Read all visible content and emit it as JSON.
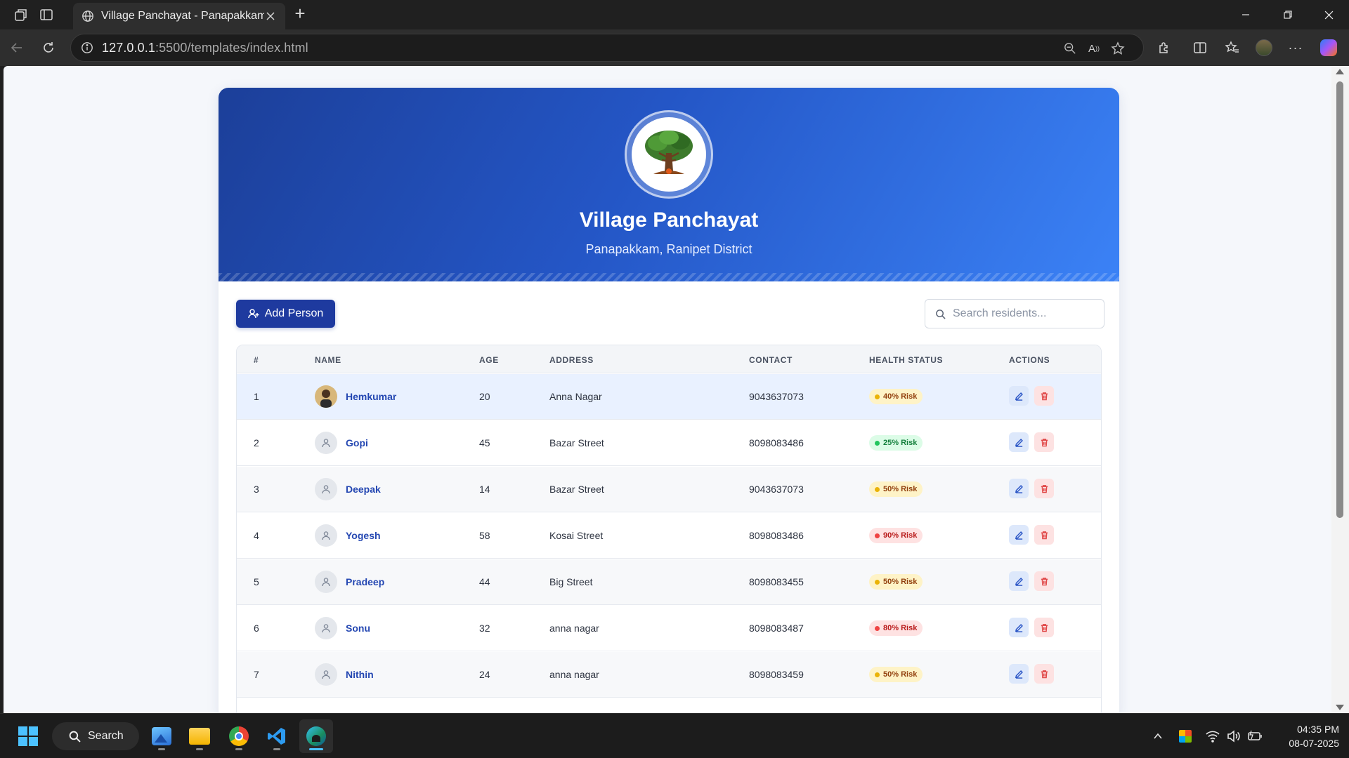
{
  "browser": {
    "tab_title": "Village Panchayat - Panapakkam",
    "url_host": "127.0.0.1",
    "url_path": ":5500/templates/index.html",
    "zoom_label": "A↑"
  },
  "header": {
    "title": "Village Panchayat",
    "subtitle": "Panapakkam, Ranipet District",
    "gradient_start": "#1c3f99",
    "gradient_end": "#3b82f6"
  },
  "toolbar": {
    "add_label": "Add Person",
    "search_placeholder": "Search residents..."
  },
  "table": {
    "columns": [
      "#",
      "NAME",
      "AGE",
      "ADDRESS",
      "CONTACT",
      "HEALTH STATUS",
      "ACTIONS"
    ],
    "rows": [
      {
        "num": "1",
        "name": "Hemkumar",
        "age": "20",
        "address": "Anna Nagar",
        "contact": "9043637073",
        "status": "40% Risk",
        "level": "medium",
        "photo": true
      },
      {
        "num": "2",
        "name": "Gopi",
        "age": "45",
        "address": "Bazar Street",
        "contact": "8098083486",
        "status": "25% Risk",
        "level": "low",
        "photo": false
      },
      {
        "num": "3",
        "name": "Deepak",
        "age": "14",
        "address": "Bazar Street",
        "contact": "9043637073",
        "status": "50% Risk",
        "level": "medium",
        "photo": false
      },
      {
        "num": "4",
        "name": "Yogesh",
        "age": "58",
        "address": "Kosai Street",
        "contact": "8098083486",
        "status": "90% Risk",
        "level": "high",
        "photo": false
      },
      {
        "num": "5",
        "name": "Pradeep",
        "age": "44",
        "address": "Big Street",
        "contact": "8098083455",
        "status": "50% Risk",
        "level": "medium",
        "photo": false
      },
      {
        "num": "6",
        "name": "Sonu",
        "age": "32",
        "address": "anna nagar",
        "contact": "8098083487",
        "status": "80% Risk",
        "level": "high",
        "photo": false
      },
      {
        "num": "7",
        "name": "Nithin",
        "age": "24",
        "address": "anna nagar",
        "contact": "8098083459",
        "status": "50% Risk",
        "level": "medium",
        "photo": false
      }
    ]
  },
  "status_colors": {
    "low": {
      "bg": "#dcfce7",
      "fg": "#15803d",
      "dot": "#22c55e"
    },
    "medium": {
      "bg": "#fef3c7",
      "fg": "#92400e",
      "dot": "#eab308"
    },
    "high": {
      "bg": "#fee2e2",
      "fg": "#b91c1c",
      "dot": "#ef4444"
    }
  },
  "taskbar": {
    "search_label": "Search",
    "time": "04:35 PM",
    "date": "08-07-2025"
  }
}
